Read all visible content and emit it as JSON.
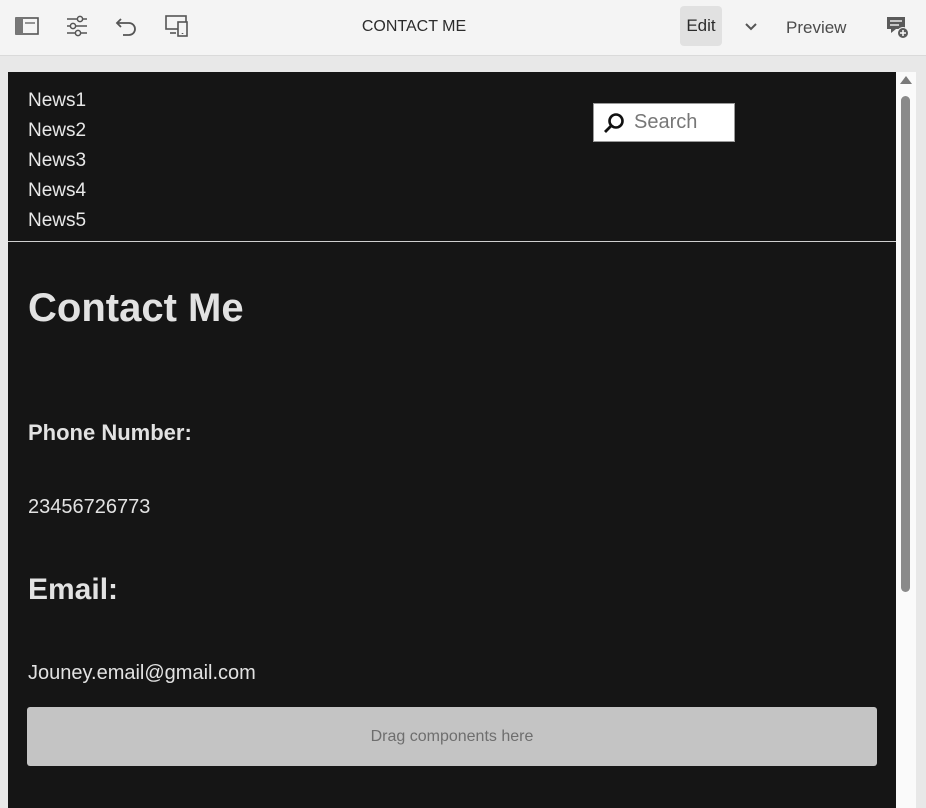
{
  "toolbar": {
    "icons": [
      "side-panel-icon",
      "page-properties-icon",
      "undo-icon",
      "emulator-icon",
      "annotations-icon"
    ],
    "title": "CONTACT ME",
    "edit_label": "Edit",
    "preview_label": "Preview"
  },
  "page": {
    "nav": [
      "News1",
      "News2",
      "News3",
      "News4",
      "News5"
    ],
    "search": {
      "placeholder": "Search"
    },
    "heading": "Contact Me",
    "phone_label": "Phone Number:",
    "phone_value": "23456726773",
    "email_label": "Email:",
    "email_value": "Jouney.email@gmail.com",
    "dropzone_label": "Drag components here"
  },
  "colors": {
    "page_background": "#151515",
    "toolbar_background": "#f4f4f4",
    "text": "#e2e2e2",
    "dropzone": "#c4c4c4"
  }
}
